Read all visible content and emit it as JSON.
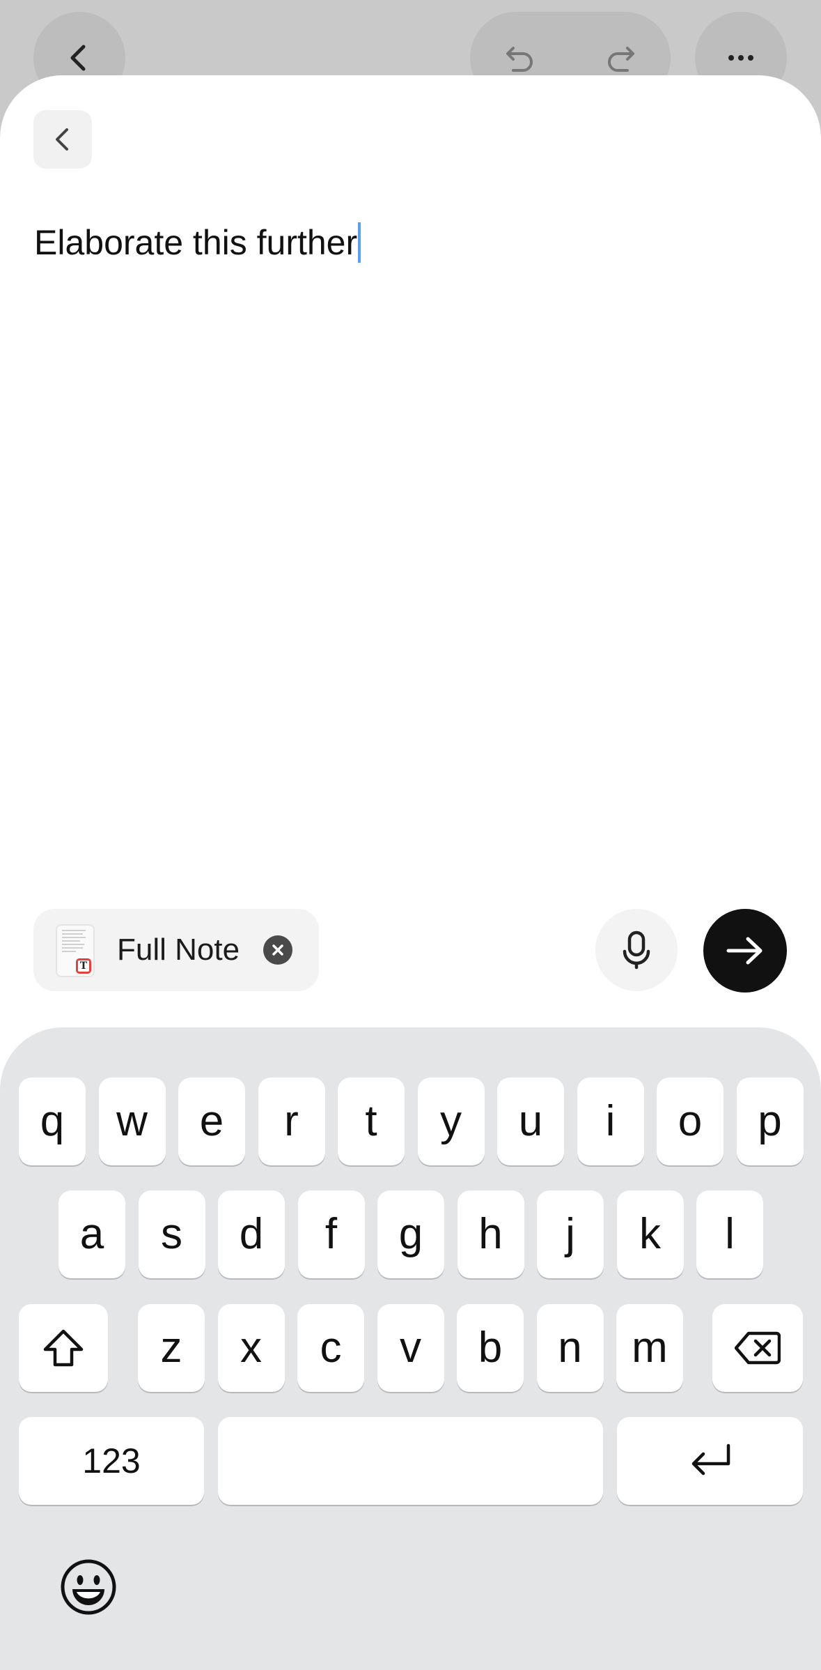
{
  "prompt": {
    "text": "Elaborate this further"
  },
  "attachment": {
    "label": "Full Note",
    "badge_letter": "T"
  },
  "keyboard": {
    "row1": [
      "q",
      "w",
      "e",
      "r",
      "t",
      "y",
      "u",
      "i",
      "o",
      "p"
    ],
    "row2": [
      "a",
      "s",
      "d",
      "f",
      "g",
      "h",
      "j",
      "k",
      "l"
    ],
    "row3": [
      "z",
      "x",
      "c",
      "v",
      "b",
      "n",
      "m"
    ],
    "numbers_label": "123"
  },
  "icons": {
    "top_back": "chevron-left-icon",
    "undo": "undo-icon",
    "redo": "redo-icon",
    "more": "more-horizontal-icon",
    "sheet_back": "chevron-left-icon",
    "mic": "microphone-icon",
    "send": "arrow-right-icon",
    "shift": "shift-icon",
    "delete": "backspace-icon",
    "return": "return-icon",
    "emoji": "emoji-icon"
  },
  "colors": {
    "send_button": "#111111",
    "caret": "#5aa0f0",
    "badge": "#e0433f",
    "keyboard_bg": "#e4e5e7"
  }
}
